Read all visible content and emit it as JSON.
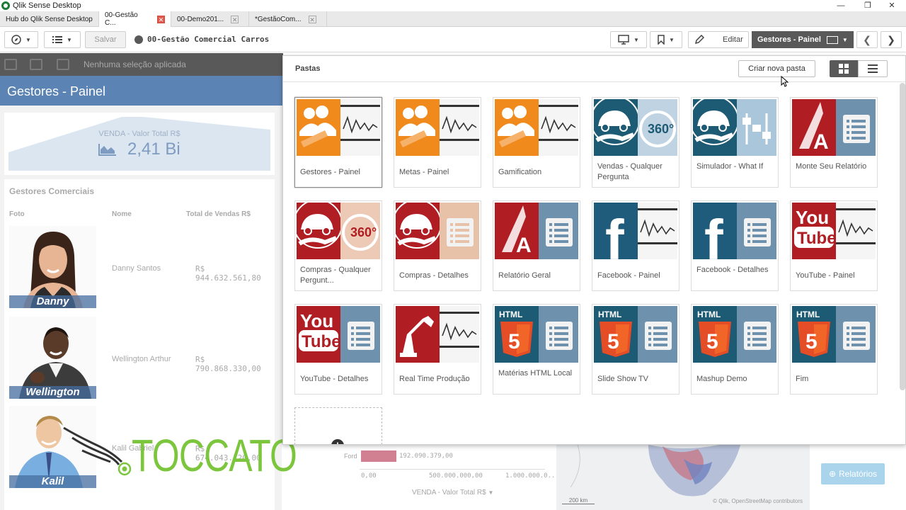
{
  "window": {
    "title": "Qlik Sense Desktop",
    "min": "—",
    "max": "❐",
    "close": "✕"
  },
  "tabs": [
    {
      "label": "Hub do Qlik Sense Desktop",
      "active": false
    },
    {
      "label": "00-Gestão C...",
      "active": true
    },
    {
      "label": "00-Demo201...",
      "active": false
    },
    {
      "label": "*GestãoCom...",
      "active": false
    }
  ],
  "toolbar": {
    "save_label": "Salvar",
    "app_title": "00-Gestão Comercial Carros",
    "edit_label": "Editar",
    "sheet_selector": "Gestores - Painel"
  },
  "selections": {
    "text": "Nenhuma seleção aplicada"
  },
  "sheet": {
    "title": "Gestores - Painel"
  },
  "kpi": {
    "label": "VENDA - Valor Total R$",
    "value": "2,41 Bi"
  },
  "managers": {
    "title": "Gestores Comerciais",
    "columns": [
      "Foto",
      "Nome",
      "Total de Vendas R$"
    ],
    "rows": [
      {
        "photo_label": "Danny",
        "name": "Danny Santos",
        "total": "R$ 944.632.561,80"
      },
      {
        "photo_label": "Wellington",
        "name": "Wellington Arthur",
        "total": "R$ 790.868.330,00"
      },
      {
        "photo_label": "Kalil",
        "name": "Kalil Gabriel",
        "total": "R$ 674.043.120,00"
      }
    ]
  },
  "watermark": {
    "text": "TOCCATO"
  },
  "background_chart": {
    "bar_category": "Ford",
    "bar_value": "192.090.379,00",
    "ticks": [
      "0,00",
      "500.000.000,00",
      "1.000.000.0..."
    ],
    "axis_title": "VENDA - Valor Total R$"
  },
  "background_map": {
    "scale": "200 km",
    "attribution": "© Qlik, OpenStreetMap contributors"
  },
  "reports_button": {
    "label": "Relatórios"
  },
  "pastas": {
    "title": "Pastas",
    "create_label": "Criar nova pasta",
    "sheets": [
      {
        "label": "Gestores - Painel",
        "thumb": "team-chart"
      },
      {
        "label": "Metas - Painel",
        "thumb": "team-chart"
      },
      {
        "label": "Gamification",
        "thumb": "team-chart"
      },
      {
        "label": "Vendas - Qualquer Pergunta",
        "thumb": "car-360"
      },
      {
        "label": "Simulador - What If",
        "thumb": "car-sliders"
      },
      {
        "label": "Monte Seu Relatório",
        "thumb": "report-list"
      },
      {
        "label": "Compras - Qualquer Pergunt...",
        "thumb": "car-360-red"
      },
      {
        "label": "Compras - Detalhes",
        "thumb": "car-list-red"
      },
      {
        "label": "Relatório Geral",
        "thumb": "report-list"
      },
      {
        "label": "Facebook - Painel",
        "thumb": "facebook-chart"
      },
      {
        "label": "Facebook - Detalhes",
        "thumb": "facebook-list"
      },
      {
        "label": "YouTube - Painel",
        "thumb": "youtube-chart"
      },
      {
        "label": "YouTube - Detalhes",
        "thumb": "youtube-list"
      },
      {
        "label": "Real Time Produção",
        "thumb": "robot-chart"
      },
      {
        "label": "Matérias HTML Local",
        "thumb": "html-list"
      },
      {
        "label": "Slide Show TV",
        "thumb": "html-list"
      },
      {
        "label": "Mashup Demo",
        "thumb": "html-list"
      },
      {
        "label": "Fim",
        "thumb": "html-list"
      }
    ]
  },
  "colors": {
    "accent": "#5b83b3",
    "toolbar_dark": "#595959",
    "watermark": "#7cc63d",
    "orange": "#f08a1c",
    "teal": "#1d5a74",
    "red": "#b01e23"
  }
}
